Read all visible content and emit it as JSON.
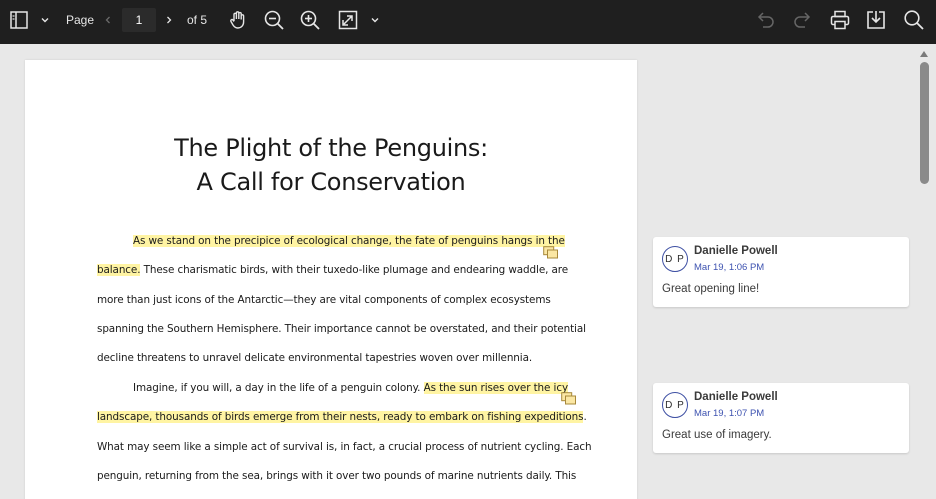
{
  "toolbar": {
    "page_label": "Page",
    "page_value": "1",
    "page_total": "of 5"
  },
  "document": {
    "title_line1": "The Plight of the Penguins:",
    "title_line2": "A Call for Conservation",
    "lines": [
      {
        "segments": [
          {
            "text": "As we stand on the precipice of ecological change, the fate of penguins hangs in the",
            "highlight": true
          }
        ],
        "indent": true
      },
      {
        "segments": [
          {
            "text": "balance.",
            "highlight": true
          },
          {
            "text": " These charismatic birds, with their tuxedo-like plumage and endearing waddle, are",
            "highlight": false
          }
        ],
        "indent": false
      },
      {
        "segments": [
          {
            "text": "more than just icons of the Antarctic—they are vital components of complex ecosystems",
            "highlight": false
          }
        ],
        "indent": false
      },
      {
        "segments": [
          {
            "text": "spanning the Southern Hemisphere. Their importance cannot be overstated, and their potential",
            "highlight": false
          }
        ],
        "indent": false
      },
      {
        "segments": [
          {
            "text": "decline threatens to unravel delicate environmental tapestries woven over millennia.",
            "highlight": false
          }
        ],
        "indent": false
      },
      {
        "segments": [
          {
            "text": "Imagine, if you will, a day in the life of a penguin colony. ",
            "highlight": false
          },
          {
            "text": "As the sun rises over the icy",
            "highlight": true
          }
        ],
        "indent": true
      },
      {
        "segments": [
          {
            "text": "landscape, thousands of birds emerge from their nests, ready to embark on fishing expeditions",
            "highlight": true
          },
          {
            "text": ".",
            "highlight": false
          }
        ],
        "indent": false
      },
      {
        "segments": [
          {
            "text": "What may seem like a simple act of survival is, in fact, a crucial process of nutrient cycling. Each",
            "highlight": false
          }
        ],
        "indent": false
      },
      {
        "segments": [
          {
            "text": "penguin, returning from the sea, brings with it over two pounds of marine nutrients daily. This",
            "highlight": false
          }
        ],
        "indent": false
      }
    ]
  },
  "comments": [
    {
      "initials": "D P",
      "author": "Danielle Powell",
      "time": "Mar 19, 1:06 PM",
      "text": "Great opening line!"
    },
    {
      "initials": "D P",
      "author": "Danielle Powell",
      "time": "Mar 19, 1:07 PM",
      "text": "Great use of imagery."
    }
  ],
  "icons": {
    "sidebar": "sidebar-toggle-icon",
    "pan": "hand-icon",
    "zoom_out": "zoom-out-icon",
    "zoom_in": "zoom-in-icon",
    "fit": "fit-page-icon",
    "undo": "undo-icon",
    "redo": "redo-icon",
    "print": "print-icon",
    "download": "download-icon",
    "search": "search-icon"
  },
  "colors": {
    "toolbar_bg": "#1f1f1f",
    "highlight": "#fff4a3",
    "accent": "#3d52b0"
  }
}
